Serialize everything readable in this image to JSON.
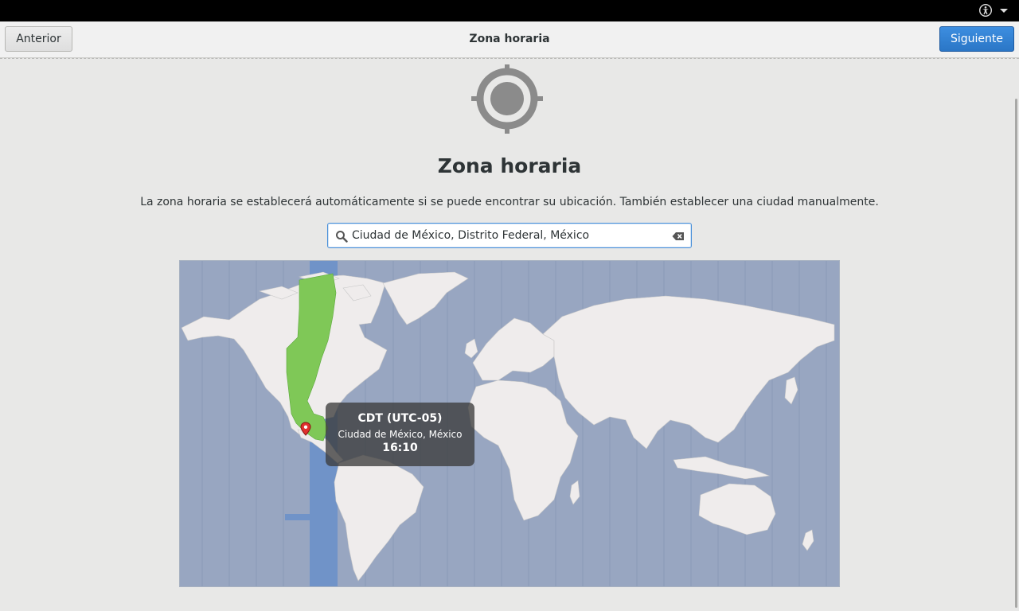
{
  "headerbar": {
    "title": "Zona horaria",
    "prev_label": "Anterior",
    "next_label": "Siguiente"
  },
  "icons": {
    "accessibility": "accessibility-icon",
    "menu": "chevron-down-icon",
    "location": "location-target-icon",
    "search": "search-icon",
    "clear": "clear-icon",
    "pin": "map-pin-icon"
  },
  "page": {
    "title": "Zona horaria",
    "description": "La zona horaria se establecerá automáticamente si se puede encontrar su ubicación. También establecer una ciudad manualmente."
  },
  "search": {
    "value": "Ciudad de México, Distrito Federal, México"
  },
  "tooltip": {
    "timezone": "CDT (UTC-05)",
    "city": "Ciudad de México, México",
    "time": "16:10"
  },
  "colors": {
    "accent": "#2d7ccb",
    "selected_zone": "#7fc857",
    "highlight_band": "#7093c8",
    "ocean": "#98a6c1",
    "land": "#efecec"
  }
}
